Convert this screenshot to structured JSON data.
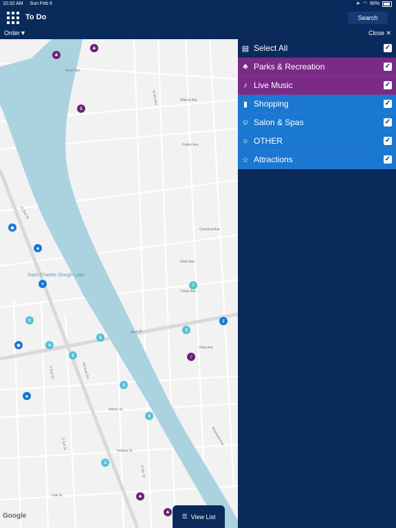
{
  "status": {
    "time": "10:32 AM",
    "date": "Sun Feb 6",
    "battery": "90%"
  },
  "topbar": {
    "title": "To Do",
    "search_label": "Search"
  },
  "subbar": {
    "order_label": "Order▼",
    "close_label": "Close ✕"
  },
  "filters": [
    {
      "label": "Select All",
      "icon": "list-icon",
      "color": "#0a2a5c",
      "checked": true
    },
    {
      "label": "Parks & Recreation",
      "icon": "park-icon",
      "color": "#7a2b86",
      "checked": true
    },
    {
      "label": "Live Music",
      "icon": "music-icon",
      "color": "#7a2b86",
      "checked": true
    },
    {
      "label": "Shopping",
      "icon": "shopping-icon",
      "color": "#1a77d2",
      "checked": true
    },
    {
      "label": "Salon & Spas",
      "icon": "salon-icon",
      "color": "#1a77d2",
      "checked": true
    },
    {
      "label": "OTHER",
      "icon": "bulb-icon",
      "color": "#1a77d2",
      "checked": true
    },
    {
      "label": "Attractions",
      "icon": "star-icon",
      "color": "#1a77d2",
      "checked": true
    }
  ],
  "map": {
    "street_labels": [
      "North Ave",
      "N 2nd St",
      "Main St",
      "Geneva Rd",
      "Riverside Ave",
      "Cedar Ave",
      "Fulton Ave",
      "Chestnut Ave",
      "State Ave",
      "Illinois St",
      "Indiana St",
      "Oak St",
      "Park Ave",
      "S 2nd St",
      "S 3rd St",
      "S 5th St",
      "Walnut Ave",
      "N 4th Ave",
      "Saint Charles Slough Lake"
    ],
    "cluster_counts": [
      "5",
      "7",
      "2",
      "3",
      "3",
      "4",
      "5",
      "2",
      "3",
      "4",
      "3"
    ],
    "google_label": "Google",
    "view_list_label": "View List"
  }
}
